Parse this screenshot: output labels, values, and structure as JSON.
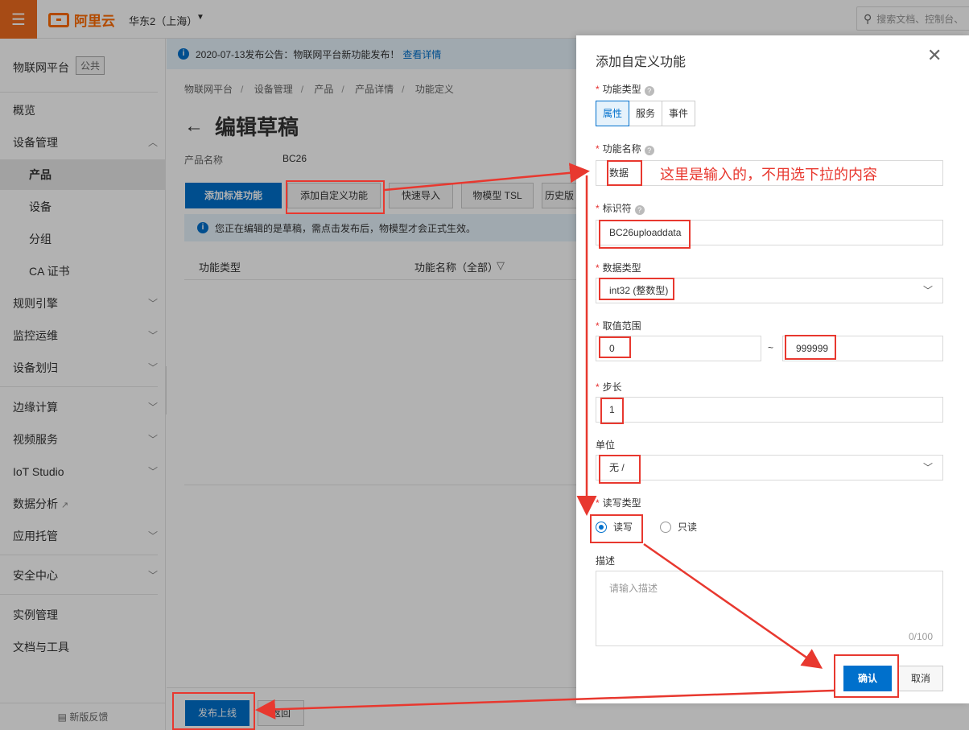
{
  "topbar": {
    "logo_text": "阿里云",
    "region": "华东2（上海）",
    "search_placeholder": "搜索文档、控制台、"
  },
  "sidebar": {
    "title": "物联网平台",
    "badge": "公共",
    "items": [
      {
        "label": "概览"
      },
      {
        "label": "设备管理"
      },
      {
        "label": "产品"
      },
      {
        "label": "设备"
      },
      {
        "label": "分组"
      },
      {
        "label": "CA 证书"
      },
      {
        "label": "规则引擎"
      },
      {
        "label": "监控运维"
      },
      {
        "label": "设备划归"
      },
      {
        "label": "边缘计算"
      },
      {
        "label": "视频服务"
      },
      {
        "label": "IoT Studio"
      },
      {
        "label": "数据分析"
      },
      {
        "label": "应用托管"
      },
      {
        "label": "安全中心"
      },
      {
        "label": "实例管理"
      },
      {
        "label": "文档与工具"
      }
    ],
    "feedback": "新版反馈"
  },
  "main": {
    "notice": "2020-07-13发布公告：物联网平台新功能发布！",
    "notice_link": "查看详情",
    "breadcrumb": [
      "物联网平台",
      "设备管理",
      "产品",
      "产品详情",
      "功能定义"
    ],
    "title": "编辑草稿",
    "product_label": "产品名称",
    "product_value": "BC26",
    "buttons": {
      "add_standard": "添加标准功能",
      "add_custom": "添加自定义功能",
      "quick_import": "快速导入",
      "tsl": "物模型 TSL",
      "history": "历史版"
    },
    "warning": "您正在编辑的是草稿，需点击发布后，物模型才会正式生效。",
    "table_headers": [
      "功能类型",
      "功能名称（全部）"
    ],
    "publish": "发布上线",
    "back": "返回"
  },
  "drawer": {
    "title": "添加自定义功能",
    "function_type_label": "功能类型",
    "function_types": [
      "属性",
      "服务",
      "事件"
    ],
    "function_name_label": "功能名称",
    "function_name_value": "数据",
    "identifier_label": "标识符",
    "identifier_value": "BC26uploaddata",
    "data_type_label": "数据类型",
    "data_type_value": "int32 (整数型)",
    "range_label": "取值范围",
    "range_min": "0",
    "range_sep": "~",
    "range_max": "999999",
    "step_label": "步长",
    "step_value": "1",
    "unit_label": "单位",
    "unit_value": "无 /",
    "rw_label": "读写类型",
    "rw_options": [
      "读写",
      "只读"
    ],
    "desc_label": "描述",
    "desc_placeholder": "请输入描述",
    "desc_count": "0/100",
    "confirm": "确认",
    "cancel": "取消"
  },
  "annotation": {
    "text": "这里是输入的，不用选下拉的内容",
    "color": "#e8382f"
  }
}
